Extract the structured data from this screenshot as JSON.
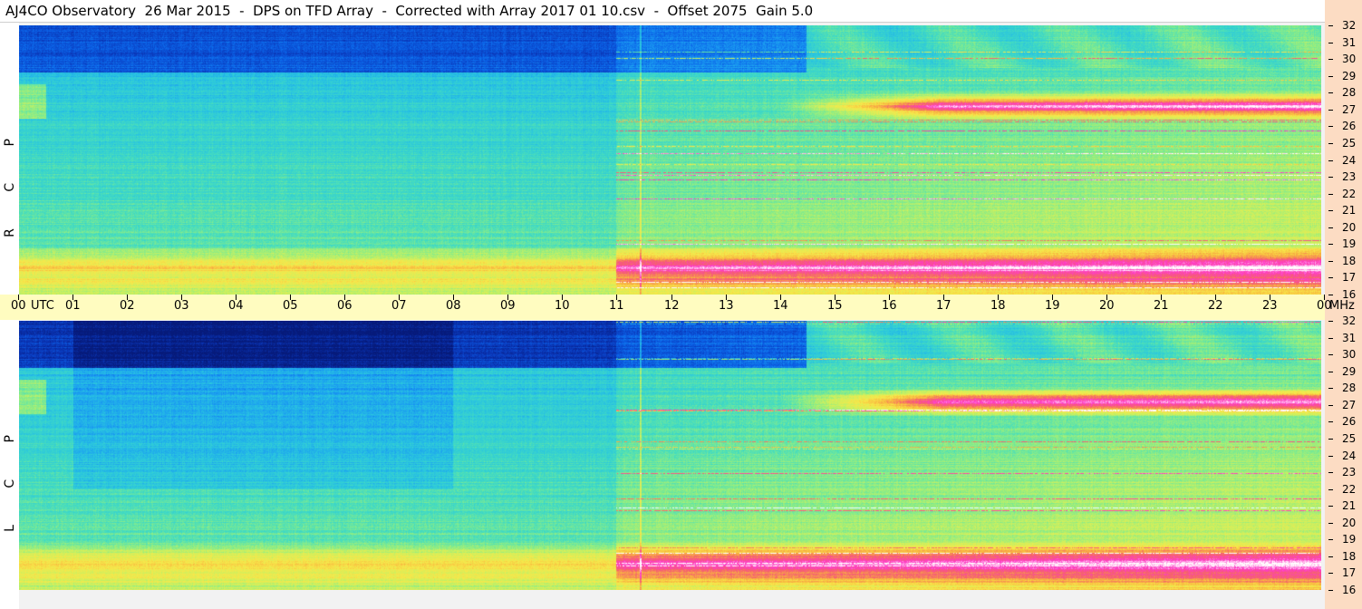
{
  "title": "AJ4CO Observatory  26 Mar 2015  -  DPS on TFD Array  -  Corrected with Array 2017 01 10.csv  -  Offset 2075  Gain 5.0",
  "chart_data": {
    "type": "heatmap",
    "panels": [
      {
        "polarization_label": "R C P"
      },
      {
        "polarization_label": "L C P"
      }
    ],
    "x_tick_labels": [
      "00",
      "UTC",
      "01",
      "02",
      "03",
      "04",
      "05",
      "06",
      "07",
      "08",
      "09",
      "10",
      "11",
      "12",
      "13",
      "14",
      "15",
      "16",
      "17",
      "18",
      "19",
      "20",
      "21",
      "22",
      "23",
      "00",
      "MHz"
    ],
    "x_hours": [
      0,
      1,
      2,
      3,
      4,
      5,
      6,
      7,
      8,
      9,
      10,
      11,
      12,
      13,
      14,
      15,
      16,
      17,
      18,
      19,
      20,
      21,
      22,
      23,
      24
    ],
    "y_tick_labels": [
      "32",
      "31",
      "30",
      "29",
      "28",
      "27",
      "26",
      "25",
      "24",
      "23",
      "22",
      "21",
      "20",
      "19",
      "18",
      "17",
      "16"
    ],
    "ylim": [
      16,
      32
    ],
    "xlim": [
      0,
      24
    ],
    "colormap": [
      "#061a7a",
      "#0a36b8",
      "#0b63e8",
      "#1a9cf2",
      "#2ac6df",
      "#44dcc0",
      "#86ec8a",
      "#cdf05e",
      "#f7e84a",
      "#f8b640",
      "#f5606e",
      "#ff3cc8",
      "#ffffff"
    ],
    "features": {
      "bright_bands_mhz": [
        27.2,
        17.6
      ],
      "sunrise_step_hour": 11.0,
      "vertical_line_hour": 11.45
    }
  },
  "colors": {
    "timebar": "#fffcc0",
    "freq_strip": "#fcdcc3",
    "title_bg": "#ffffff"
  }
}
